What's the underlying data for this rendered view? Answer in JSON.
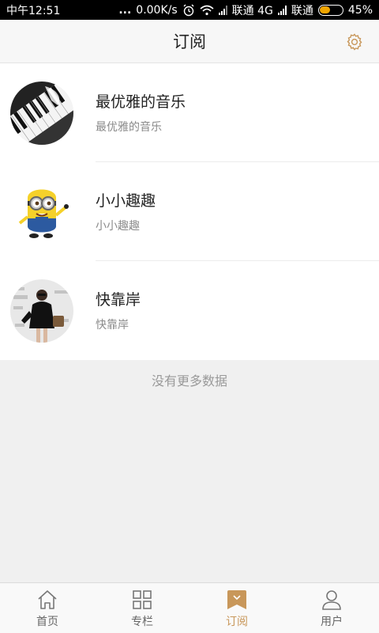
{
  "status_bar": {
    "time": "中午12:51",
    "dots": "...",
    "speed": "0.00K/s",
    "carrier1": "联通 4G",
    "carrier2": "联通",
    "battery": "45%",
    "battery_level": 0.45
  },
  "header": {
    "title": "订阅",
    "settings_icon": "gear-icon"
  },
  "subscriptions": [
    {
      "name": "最优雅的音乐",
      "subtitle": "最优雅的音乐",
      "avatar": "piano-keys-photo"
    },
    {
      "name": "小小趣趣",
      "subtitle": "小小趣趣",
      "avatar": "minion-cartoon"
    },
    {
      "name": "快靠岸",
      "subtitle": "快靠岸",
      "avatar": "fashion-woman-photo"
    }
  ],
  "footer_text": "没有更多数据",
  "bottom_nav": [
    {
      "label": "首页",
      "icon": "home-icon",
      "active": false
    },
    {
      "label": "专栏",
      "icon": "grid-icon",
      "active": false
    },
    {
      "label": "订阅",
      "icon": "bookmark-icon",
      "active": true
    },
    {
      "label": "用户",
      "icon": "user-icon",
      "active": false
    }
  ],
  "colors": {
    "accent": "#c8975a",
    "status_bar": "#000000",
    "battery_fill": "#f0a500"
  }
}
